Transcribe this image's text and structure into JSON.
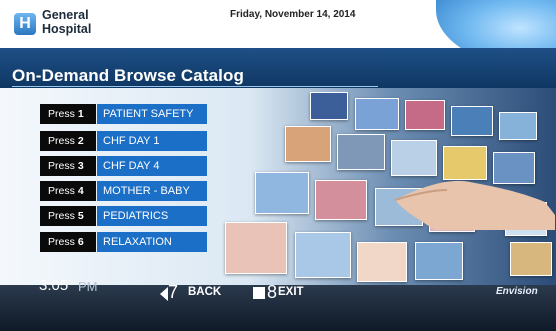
{
  "header": {
    "logo_letter": "H",
    "hospital_line1": "General",
    "hospital_line2": "Hospital",
    "date": "Friday, November 14, 2014"
  },
  "title": "On-Demand Browse Catalog",
  "menu": {
    "press_label": "Press",
    "items": [
      {
        "key": "1",
        "label": "PATIENT SAFETY"
      },
      {
        "key": "2",
        "label": "CHF DAY 1"
      },
      {
        "key": "3",
        "label": "CHF DAY 4"
      },
      {
        "key": "4",
        "label": "MOTHER - BABY"
      },
      {
        "key": "5",
        "label": "PEDIATRICS"
      },
      {
        "key": "6",
        "label": "RELAXATION"
      }
    ]
  },
  "footer": {
    "time": "3:05",
    "ampm": "PM",
    "back_number": "7",
    "back_label": "BACK",
    "exit_number": "8",
    "exit_label": "EXIT",
    "brand": "Envision"
  },
  "colors": {
    "option_blue": "#1c6fc7",
    "press_black": "#0a0a0a",
    "title_band": "#1e4f86"
  }
}
